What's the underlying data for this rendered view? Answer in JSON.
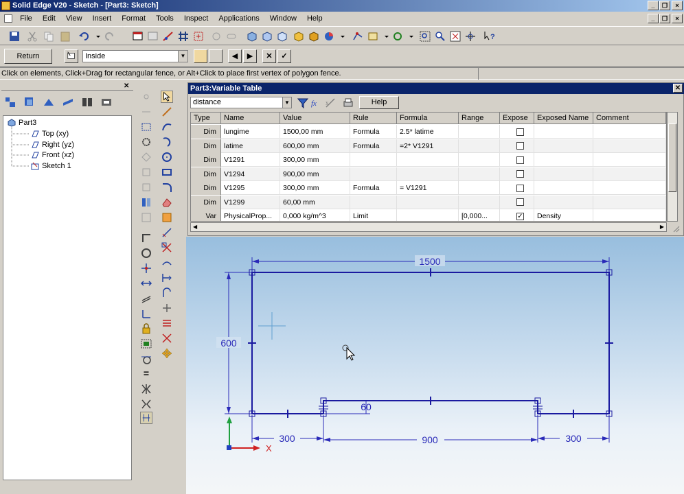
{
  "window": {
    "title": "Solid Edge V20 - Sketch - [Part3: Sketch]"
  },
  "menu": [
    "File",
    "Edit",
    "View",
    "Insert",
    "Format",
    "Tools",
    "Inspect",
    "Applications",
    "Window",
    "Help"
  ],
  "ribbon": {
    "return_label": "Return",
    "select_mode_value": "Inside"
  },
  "status": {
    "prompt": "Click on elements, Click+Drag for rectangular fence, or Alt+Click to place first vertex of polygon fence."
  },
  "tree": {
    "root": "Part3",
    "items": [
      "Top (xy)",
      "Right (yz)",
      "Front (xz)",
      "Sketch 1"
    ]
  },
  "variable_table": {
    "title": "Part3:Variable Table",
    "filter_value": "distance",
    "help_label": "Help",
    "columns": [
      "Type",
      "Name",
      "Value",
      "Rule",
      "Formula",
      "Range",
      "Expose",
      "Exposed Name",
      "Comment"
    ],
    "rows": [
      {
        "type": "Dim",
        "name": "lungime",
        "value": "1500,00 mm",
        "rule": "Formula",
        "formula": "2.5* latime",
        "range": "",
        "expose": "",
        "exposed_name": "",
        "comment": ""
      },
      {
        "type": "Dim",
        "name": "latime",
        "value": "600,00 mm",
        "rule": "Formula",
        "formula": "=2* V1291",
        "range": "",
        "expose": "",
        "exposed_name": "",
        "comment": ""
      },
      {
        "type": "Dim",
        "name": "V1291",
        "value": "300,00 mm",
        "rule": "",
        "formula": "",
        "range": "",
        "expose": "",
        "exposed_name": "",
        "comment": ""
      },
      {
        "type": "Dim",
        "name": "V1294",
        "value": "900,00 mm",
        "rule": "",
        "formula": "",
        "range": "",
        "expose": "",
        "exposed_name": "",
        "comment": ""
      },
      {
        "type": "Dim",
        "name": "V1295",
        "value": "300,00 mm",
        "rule": "Formula",
        "formula": "= V1291",
        "range": "",
        "expose": "",
        "exposed_name": "",
        "comment": ""
      },
      {
        "type": "Dim",
        "name": "V1299",
        "value": "60,00 mm",
        "rule": "",
        "formula": "",
        "range": "",
        "expose": "",
        "exposed_name": "",
        "comment": ""
      },
      {
        "type": "Var",
        "name": "PhysicalProp...",
        "value": "0,000 kg/m^3",
        "rule": "Limit",
        "formula": "",
        "range": "[0,000...",
        "expose": "✓",
        "exposed_name": "Density",
        "comment": ""
      }
    ]
  },
  "sketch": {
    "dim_top": "1500",
    "dim_left": "600",
    "dim_inner": "60",
    "dim_bottom_left": "300",
    "dim_bottom_mid": "900",
    "dim_bottom_right": "300",
    "axis_x_label": "X",
    "line_color": "#1a1aa0",
    "dim_color": "#2a2ab8"
  }
}
